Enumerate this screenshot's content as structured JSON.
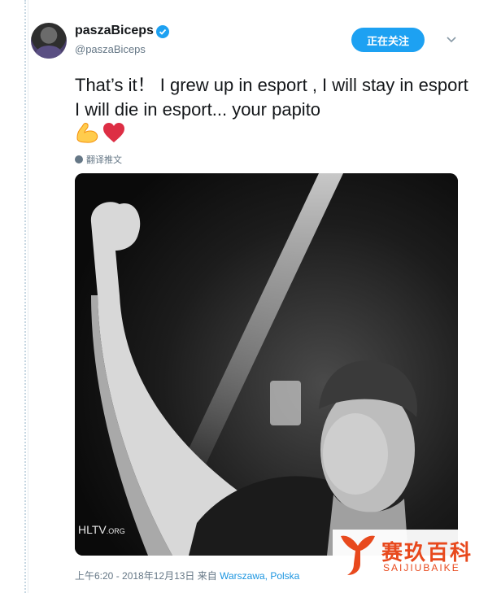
{
  "user": {
    "display_name": "paszaBiceps",
    "handle": "@paszaBiceps",
    "verified": true
  },
  "header": {
    "follow_label": "正在关注"
  },
  "tweet": {
    "text": "That’s it！ I grew up in esport , I will stay in esport I will die in esport... your papito",
    "emojis": [
      "flexed-biceps",
      "red-heart"
    ],
    "translate_label": "翻译推文"
  },
  "media": {
    "watermark_main": "HLTV",
    "watermark_suffix": ".ORG"
  },
  "footer": {
    "timestamp": "上午6:20 - 2018年12月13日 来自",
    "location": "Warszawa, Polska"
  },
  "brand": {
    "title": "赛玖百科",
    "subtitle": "SAIJIUBAIKE"
  },
  "colors": {
    "accent": "#1da1f2",
    "location_link": "#1b95e0",
    "brand": "#e8491d",
    "muted": "#657786"
  }
}
